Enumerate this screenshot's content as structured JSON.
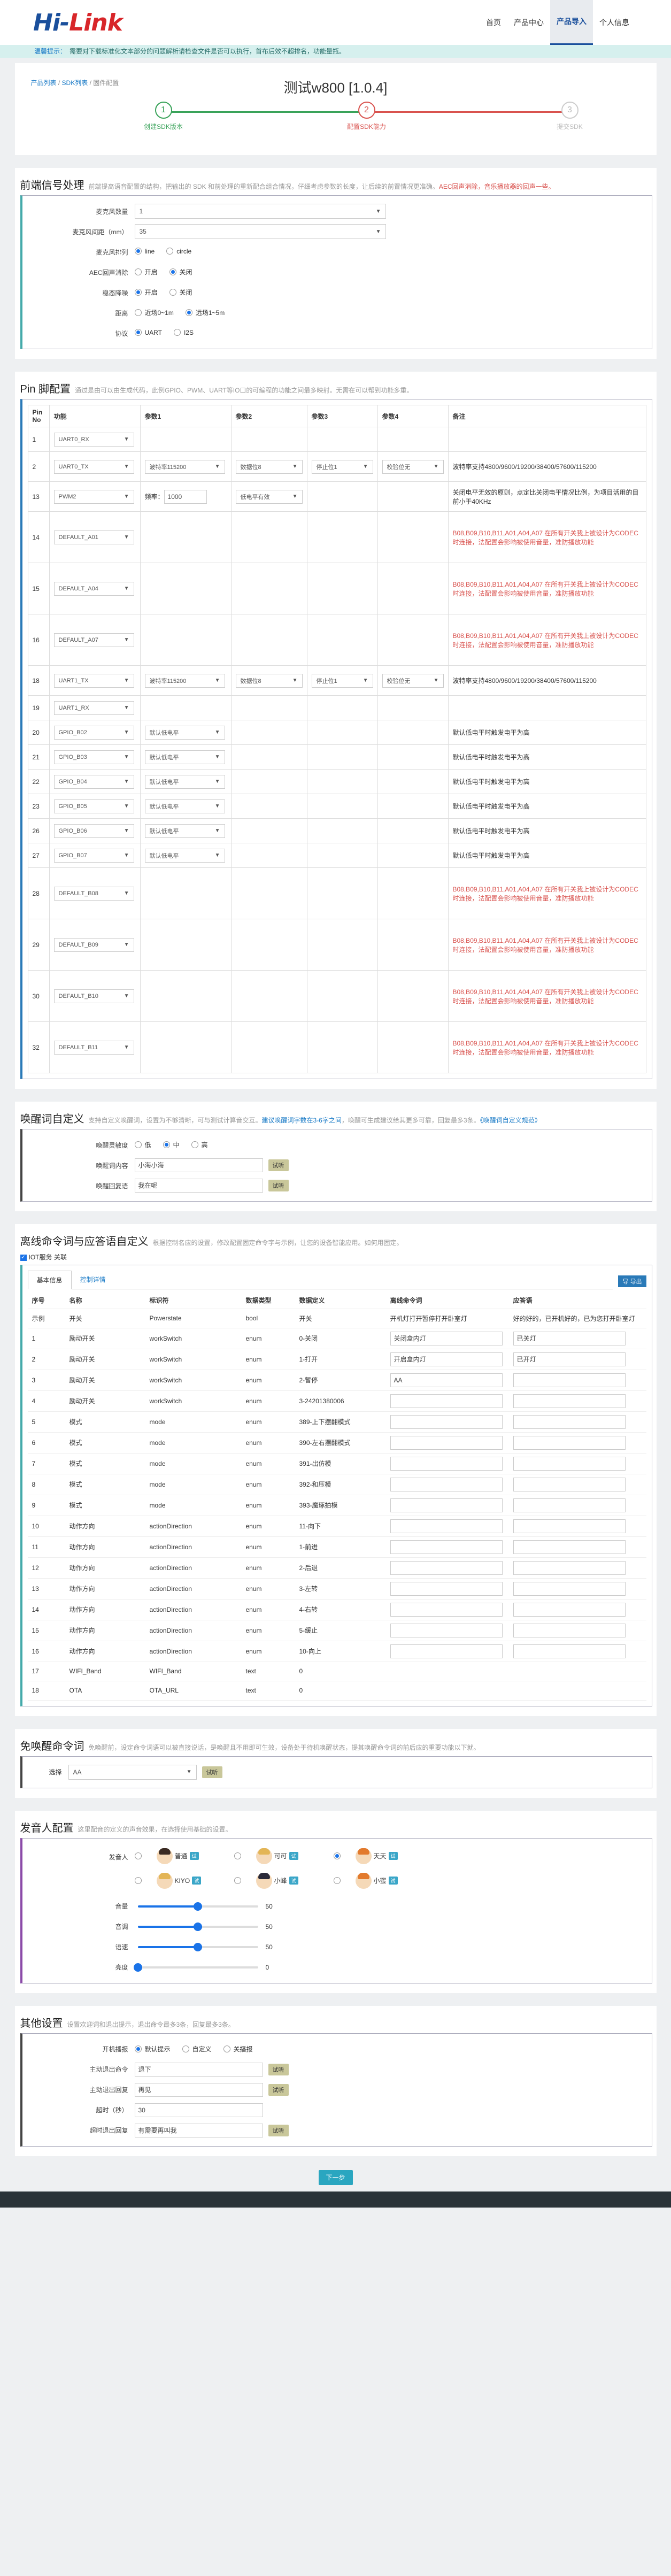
{
  "header": {
    "logo_main": "Hi-",
    "logo_accent": "Link",
    "nav": [
      "首页",
      "产品中心",
      "产品导入",
      "个人信息"
    ],
    "nav_active": 2
  },
  "notice": {
    "label": "温馨提示：",
    "text": "需要对下载标准化文本部分的问题解析请检查文件是否可以执行，首布后效不超排名，功能量瓶。"
  },
  "breadcrumb": {
    "items": [
      "产品列表",
      "SDK列表",
      "固件配置"
    ]
  },
  "page_title": "测试w800  [1.0.4]",
  "steps": [
    {
      "num": "1",
      "label": "创建SDK版本"
    },
    {
      "num": "2",
      "label": "配置SDK能力"
    },
    {
      "num": "3",
      "label": "提交SDK"
    }
  ],
  "frontend": {
    "title": "前端信号处理",
    "desc": "前端提高语音配置的结构，把输出的 SDK 和前处理的重新配合组合情况，仔细考虑参数的长度，让后续的前置情况更准确。",
    "desc_red": "AEC回声消除，音乐播放器的回声一些。",
    "rows": [
      {
        "label": "麦克风数量",
        "value": "1"
      },
      {
        "label": "麦克风间距（mm）",
        "value": "35"
      }
    ],
    "radios": [
      {
        "label": "麦克风排列",
        "opts": [
          "line",
          "circle"
        ],
        "on": 0
      },
      {
        "label": "AEC回声消除",
        "opts": [
          "开启",
          "关闭"
        ],
        "on": 1
      },
      {
        "label": "稳态降噪",
        "opts": [
          "开启",
          "关闭"
        ],
        "on": 0
      },
      {
        "label": "距离",
        "opts": [
          "近场0~1m",
          "远场1~5m"
        ],
        "on": 1
      },
      {
        "label": "协议",
        "opts": [
          "UART",
          "I2S"
        ],
        "on": 0
      }
    ]
  },
  "pin": {
    "title": "Pin 脚配置",
    "desc": "通过是由可以由生成代码，此例GPIO、PWM、UART等IO口的可编程的功能之间最多映射。无需在可以帮到功能多重。",
    "headers": [
      "Pin No",
      "功能",
      "参数1",
      "参数2",
      "参数3",
      "参数4",
      "备注"
    ],
    "rows": [
      {
        "no": "1",
        "func": "UART0_RX",
        "p1": "",
        "p2": "",
        "p3": "",
        "p4": "",
        "note": "",
        "red": false
      },
      {
        "no": "2",
        "func": "UART0_TX",
        "p1": "波特率115200",
        "p2": "数据位8",
        "p3": "停止位1",
        "p4": "校验位无",
        "note": "波特率支持4800/9600/19200/38400/57600/115200",
        "red": false
      },
      {
        "no": "13",
        "func": "PWM2",
        "p1": "PWM",
        "p2": "低电平有效",
        "p3": "",
        "p4": "",
        "note": "关闭电平无效的原则，点定比关闭电平情况比例，为项目活用的目前小于40KHz",
        "red": false
      },
      {
        "no": "14",
        "func": "DEFAULT_A01",
        "p1": "",
        "p2": "",
        "p3": "",
        "p4": "",
        "note": "B08,B09,B10,B11,A01,A04,A07 在所有开关我上被设计为CODEC 时连接，法配置会影响被使用音量，准防播放功能",
        "red": true
      },
      {
        "no": "15",
        "func": "DEFAULT_A04",
        "p1": "",
        "p2": "",
        "p3": "",
        "p4": "",
        "note": "B08,B09,B10,B11,A01,A04,A07 在所有开关我上被设计为CODEC 时连接，法配置会影响被使用音量，准防播放功能",
        "red": true
      },
      {
        "no": "16",
        "func": "DEFAULT_A07",
        "p1": "",
        "p2": "",
        "p3": "",
        "p4": "",
        "note": "B08,B09,B10,B11,A01,A04,A07 在所有开关我上被设计为CODEC 时连接，法配置会影响被使用音量，准防播放功能",
        "red": true
      },
      {
        "no": "18",
        "func": "UART1_TX",
        "p1": "波特率115200",
        "p2": "数据位8",
        "p3": "停止位1",
        "p4": "校验位无",
        "note": "波特率支持4800/9600/19200/38400/57600/115200",
        "red": false
      },
      {
        "no": "19",
        "func": "UART1_RX",
        "p1": "",
        "p2": "",
        "p3": "",
        "p4": "",
        "note": "",
        "red": false
      },
      {
        "no": "20",
        "func": "GPIO_B02",
        "p1": "默认低电平",
        "p2": "",
        "p3": "",
        "p4": "",
        "note": "默认低电平时触发电平为高",
        "red": false
      },
      {
        "no": "21",
        "func": "GPIO_B03",
        "p1": "默认低电平",
        "p2": "",
        "p3": "",
        "p4": "",
        "note": "默认低电平时触发电平为高",
        "red": false
      },
      {
        "no": "22",
        "func": "GPIO_B04",
        "p1": "默认低电平",
        "p2": "",
        "p3": "",
        "p4": "",
        "note": "默认低电平时触发电平为高",
        "red": false
      },
      {
        "no": "23",
        "func": "GPIO_B05",
        "p1": "默认低电平",
        "p2": "",
        "p3": "",
        "p4": "",
        "note": "默认低电平时触发电平为高",
        "red": false
      },
      {
        "no": "26",
        "func": "GPIO_B06",
        "p1": "默认低电平",
        "p2": "",
        "p3": "",
        "p4": "",
        "note": "默认低电平时触发电平为高",
        "red": false
      },
      {
        "no": "27",
        "func": "GPIO_B07",
        "p1": "默认低电平",
        "p2": "",
        "p3": "",
        "p4": "",
        "note": "默认低电平时触发电平为高",
        "red": false
      },
      {
        "no": "28",
        "func": "DEFAULT_B08",
        "p1": "",
        "p2": "",
        "p3": "",
        "p4": "",
        "note": "B08,B09,B10,B11,A01,A04,A07 在所有开关我上被设计为CODEC 时连接，法配置会影响被使用音量，准防播放功能",
        "red": true
      },
      {
        "no": "29",
        "func": "DEFAULT_B09",
        "p1": "",
        "p2": "",
        "p3": "",
        "p4": "",
        "note": "B08,B09,B10,B11,A01,A04,A07 在所有开关我上被设计为CODEC 时连接，法配置会影响被使用音量，准防播放功能",
        "red": true
      },
      {
        "no": "30",
        "func": "DEFAULT_B10",
        "p1": "",
        "p2": "",
        "p3": "",
        "p4": "",
        "note": "B08,B09,B10,B11,A01,A04,A07 在所有开关我上被设计为CODEC 时连接，法配置会影响被使用音量，准防播放功能",
        "red": true
      },
      {
        "no": "32",
        "func": "DEFAULT_B11",
        "p1": "",
        "p2": "",
        "p3": "",
        "p4": "",
        "note": "B08,B09,B10,B11,A01,A04,A07 在所有开关我上被设计为CODEC 时连接，法配置会影响被使用音量，准防播放功能",
        "red": true
      }
    ],
    "pwm_freq_label": "频率：",
    "pwm_freq_value": "1000"
  },
  "wake": {
    "title": "唤醒词自定义",
    "desc": "支持自定义唤醒词，设置为不够清晰，可与测试计算音交互。",
    "desc_link": "建议唤醒词字数在3-6字之间",
    "desc_tail": "，唤醒可生成建议给其更多可靠，回复最多3条。",
    "desc_link2": "《唤醒词自定义规范》",
    "rows": [
      {
        "label": "唤醒灵敏度",
        "type": "radio",
        "opts": [
          "低",
          "中",
          "高"
        ],
        "on": 1
      },
      {
        "label": "唤醒词内容",
        "type": "input",
        "value": "小海小海",
        "btn": "试听"
      },
      {
        "label": "唤醒回复语",
        "type": "input",
        "value": "我在呢",
        "btn": "试听"
      }
    ]
  },
  "offline": {
    "title": "离线命令词与应答语自定义",
    "desc": "根据控制名应的设置，修改配置固定命令字与示例，让您的设备智能应用。如何用固定。",
    "iot_label": "IOT服务 关联",
    "tabs": [
      "基本信息",
      "控制详情"
    ],
    "export": "导 导出",
    "headers": [
      "序号",
      "名称",
      "标识符",
      "数据类型",
      "数据定义",
      "离线命令词",
      "应答语"
    ],
    "rows": [
      {
        "n": "示例",
        "name": "开关",
        "id": "Powerstate",
        "type": "bool",
        "def": "开关",
        "cmd": "开机灯打开暂停打开卧室灯",
        "reply": "好的好的，已开机好的，已为您打开卧室灯",
        "plain": true
      },
      {
        "n": "1",
        "name": "励动开关",
        "id": "workSwitch",
        "type": "enum",
        "def": "0-关闭",
        "cmd": "关闭盒内灯",
        "reply": "已关灯",
        "plain": false
      },
      {
        "n": "2",
        "name": "励动开关",
        "id": "workSwitch",
        "type": "enum",
        "def": "1-打开",
        "cmd": "开启盒内灯",
        "reply": "已开灯",
        "plain": false
      },
      {
        "n": "3",
        "name": "励动开关",
        "id": "workSwitch",
        "type": "enum",
        "def": "2-暂停",
        "cmd": "AA",
        "reply": "",
        "plain": false
      },
      {
        "n": "4",
        "name": "励动开关",
        "id": "workSwitch",
        "type": "enum",
        "def": "3-24201380006",
        "cmd": "",
        "reply": "",
        "plain": false
      },
      {
        "n": "5",
        "name": "模式",
        "id": "mode",
        "type": "enum",
        "def": "389-上下摆翻模式",
        "cmd": "",
        "reply": "",
        "plain": false
      },
      {
        "n": "6",
        "name": "模式",
        "id": "mode",
        "type": "enum",
        "def": "390-左右摆翻模式",
        "cmd": "",
        "reply": "",
        "plain": false
      },
      {
        "n": "7",
        "name": "模式",
        "id": "mode",
        "type": "enum",
        "def": "391-出仿模",
        "cmd": "",
        "reply": "",
        "plain": false
      },
      {
        "n": "8",
        "name": "模式",
        "id": "mode",
        "type": "enum",
        "def": "392-和压模",
        "cmd": "",
        "reply": "",
        "plain": false
      },
      {
        "n": "9",
        "name": "模式",
        "id": "mode",
        "type": "enum",
        "def": "393-魔琢拍模",
        "cmd": "",
        "reply": "",
        "plain": false
      },
      {
        "n": "10",
        "name": "动作方向",
        "id": "actionDirection",
        "type": "enum",
        "def": "11-向下",
        "cmd": "",
        "reply": "",
        "plain": false
      },
      {
        "n": "11",
        "name": "动作方向",
        "id": "actionDirection",
        "type": "enum",
        "def": "1-前进",
        "cmd": "",
        "reply": "",
        "plain": false
      },
      {
        "n": "12",
        "name": "动作方向",
        "id": "actionDirection",
        "type": "enum",
        "def": "2-后退",
        "cmd": "",
        "reply": "",
        "plain": false
      },
      {
        "n": "13",
        "name": "动作方向",
        "id": "actionDirection",
        "type": "enum",
        "def": "3-左转",
        "cmd": "",
        "reply": "",
        "plain": false
      },
      {
        "n": "14",
        "name": "动作方向",
        "id": "actionDirection",
        "type": "enum",
        "def": "4-右转",
        "cmd": "",
        "reply": "",
        "plain": false
      },
      {
        "n": "15",
        "name": "动作方向",
        "id": "actionDirection",
        "type": "enum",
        "def": "5-缓止",
        "cmd": "",
        "reply": "",
        "plain": false
      },
      {
        "n": "16",
        "name": "动作方向",
        "id": "actionDirection",
        "type": "enum",
        "def": "10-向上",
        "cmd": "",
        "reply": "",
        "plain": false
      },
      {
        "n": "17",
        "name": "WIFI_Band",
        "id": "WIFI_Band",
        "type": "text",
        "def": "0",
        "cmd": "",
        "reply": "",
        "plain": true
      },
      {
        "n": "18",
        "name": "OTA",
        "id": "OTA_URL",
        "type": "text",
        "def": "0",
        "cmd": "",
        "reply": "",
        "plain": true
      }
    ]
  },
  "freewake": {
    "title": "免唤醒命令词",
    "desc": "免唤醒前，设定命令词语可以被直接说话，是唤醒且不用即可生效，设备处于待机唤醒状态，提其唤醒命令词的前后应的重要功能以下就。",
    "label": "选择",
    "value": "AA",
    "btn": "试听"
  },
  "speaker": {
    "title": "发音人配置",
    "desc": "这里配音的定义的声音效果，在选择使用基础的设置。",
    "label": "发音人",
    "voices": [
      {
        "name": "普通",
        "tag": "试",
        "av": "",
        "on": false
      },
      {
        "name": "可可",
        "tag": "试",
        "av": "blonde",
        "on": false
      },
      {
        "name": "天天",
        "tag": "试",
        "av": "orange",
        "on": true
      },
      {
        "name": "KIYO",
        "tag": "试",
        "av": "blonde",
        "on": false
      },
      {
        "name": "小峰",
        "tag": "试",
        "av": "kid",
        "on": false
      },
      {
        "name": "小蜜",
        "tag": "试",
        "av": "orange",
        "on": false
      }
    ],
    "sliders": [
      {
        "label": "音量",
        "value": 50
      },
      {
        "label": "音调",
        "value": 50
      },
      {
        "label": "语速",
        "value": 50
      },
      {
        "label": "亮度",
        "value": 0
      }
    ]
  },
  "other": {
    "title": "其他设置",
    "desc": "设置欢迎词和退出提示，退出命令最多3条，回复最多3条。",
    "mode_label": "开机播报",
    "mode_opts": [
      "默认提示",
      "自定义",
      "关播报"
    ],
    "mode_on": 0,
    "rows": [
      {
        "label": "主动退出命令",
        "value": "退下",
        "btn": "试听"
      },
      {
        "label": "主动退出回复",
        "value": "再见",
        "btn": "试听"
      },
      {
        "label": "超时（秒）",
        "value": "30",
        "btn": ""
      },
      {
        "label": "超时退出回复",
        "value": "有需要再叫我",
        "btn": "试听"
      }
    ]
  },
  "next_btn": "下一步"
}
